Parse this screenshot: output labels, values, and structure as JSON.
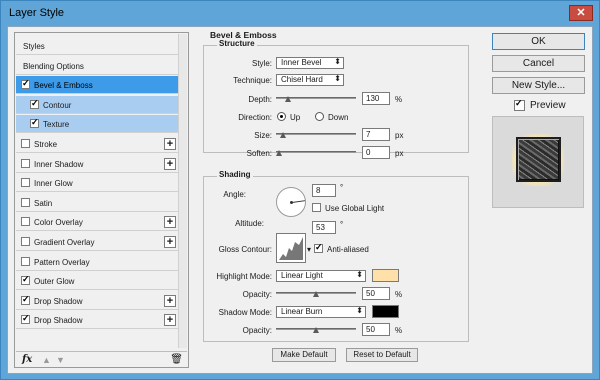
{
  "window": {
    "title": "Layer Style",
    "close": "✕"
  },
  "left_panel": {
    "items": [
      {
        "label": "Styles",
        "checkbox": null,
        "checked": false,
        "plus": false,
        "state": "normal",
        "sub": false
      },
      {
        "label": "Blending Options",
        "checkbox": null,
        "checked": false,
        "plus": false,
        "state": "normal",
        "sub": false
      },
      {
        "label": "Bevel & Emboss",
        "checkbox": true,
        "checked": true,
        "plus": false,
        "state": "selected",
        "sub": false
      },
      {
        "label": "Contour",
        "checkbox": true,
        "checked": true,
        "plus": false,
        "state": "subselected",
        "sub": true
      },
      {
        "label": "Texture",
        "checkbox": true,
        "checked": true,
        "plus": false,
        "state": "subselected",
        "sub": true
      },
      {
        "label": "Stroke",
        "checkbox": true,
        "checked": false,
        "plus": true,
        "state": "normal",
        "sub": false
      },
      {
        "label": "Inner Shadow",
        "checkbox": true,
        "checked": false,
        "plus": true,
        "state": "normal",
        "sub": false
      },
      {
        "label": "Inner Glow",
        "checkbox": true,
        "checked": false,
        "plus": false,
        "state": "normal",
        "sub": false
      },
      {
        "label": "Satin",
        "checkbox": true,
        "checked": false,
        "plus": false,
        "state": "normal",
        "sub": false
      },
      {
        "label": "Color Overlay",
        "checkbox": true,
        "checked": false,
        "plus": true,
        "state": "normal",
        "sub": false
      },
      {
        "label": "Gradient Overlay",
        "checkbox": true,
        "checked": false,
        "plus": true,
        "state": "normal",
        "sub": false
      },
      {
        "label": "Pattern Overlay",
        "checkbox": true,
        "checked": false,
        "plus": false,
        "state": "normal",
        "sub": false
      },
      {
        "label": "Outer Glow",
        "checkbox": true,
        "checked": true,
        "plus": false,
        "state": "normal",
        "sub": false
      },
      {
        "label": "Drop Shadow",
        "checkbox": true,
        "checked": true,
        "plus": true,
        "state": "normal",
        "sub": false
      },
      {
        "label": "Drop Shadow",
        "checkbox": true,
        "checked": true,
        "plus": true,
        "state": "normal",
        "sub": false
      }
    ],
    "plus_symbol": "+",
    "fx": "fx",
    "up": "▲",
    "down": "▼",
    "trash": "🗑"
  },
  "bevel": {
    "section_title": "Bevel & Emboss",
    "structure_title": "Structure",
    "style_label": "Style:",
    "style_value": "Inner Bevel",
    "technique_label": "Technique:",
    "technique_value": "Chisel Hard",
    "depth_label": "Depth:",
    "depth_value": "130",
    "depth_unit": "%",
    "depth_level": 0.13,
    "direction_label": "Direction:",
    "dir_up": "Up",
    "dir_down": "Down",
    "size_label": "Size:",
    "size_value": "7",
    "size_unit": "px",
    "size_level": 0.05,
    "soften_label": "Soften:",
    "soften_value": "0",
    "soften_unit": "px",
    "soften_level": 0.0
  },
  "shading": {
    "title": "Shading",
    "angle_label": "Angle:",
    "angle_value": "8",
    "angle_unit": "°",
    "use_global": "Use Global Light",
    "altitude_label": "Altitude:",
    "altitude_value": "53",
    "altitude_unit": "°",
    "gloss_label": "Gloss Contour:",
    "anti_aliased": "Anti-aliased",
    "highlight_label": "Highlight Mode:",
    "highlight_value": "Linear Light",
    "highlight_color": "#ffe0a8",
    "hl_opacity_label": "Opacity:",
    "hl_opacity_value": "50",
    "hl_opacity_unit": "%",
    "hl_opacity_level": 0.5,
    "shadow_label": "Shadow Mode:",
    "shadow_value": "Linear Burn",
    "shadow_color": "#000000",
    "sh_opacity_label": "Opacity:",
    "sh_opacity_value": "50",
    "sh_opacity_unit": "%",
    "sh_opacity_level": 0.5
  },
  "buttons": {
    "make_default": "Make Default",
    "reset_default": "Reset to Default",
    "ok": "OK",
    "cancel": "Cancel",
    "new_style": "New Style...",
    "preview": "Preview"
  }
}
